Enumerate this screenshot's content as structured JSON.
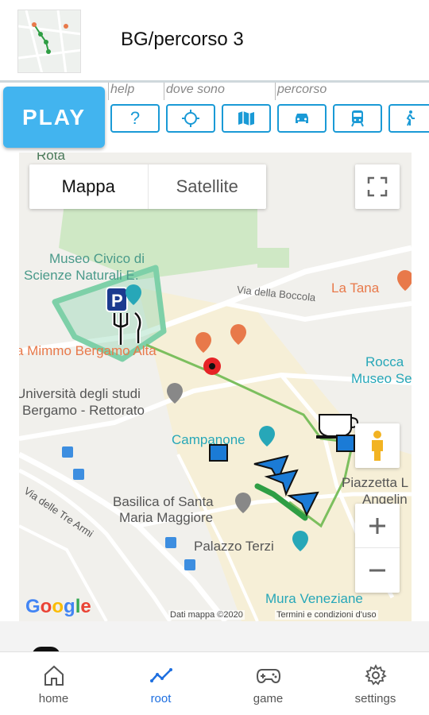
{
  "header": {
    "title": "BG/percorso 3"
  },
  "play_label": "PLAY",
  "categories": [
    {
      "label": "help"
    },
    {
      "label": "dove sono"
    },
    {
      "label": "percorso"
    }
  ],
  "toolbar": [
    {
      "icon": "question-icon",
      "text": "?"
    },
    {
      "icon": "locate-icon"
    },
    {
      "icon": "map-icon"
    },
    {
      "icon": "car-icon"
    },
    {
      "icon": "train-icon"
    },
    {
      "icon": "walk-icon"
    }
  ],
  "map": {
    "type_controls": {
      "map": "Mappa",
      "satellite": "Satellite"
    },
    "labels": {
      "rota": "Rota",
      "museo_civico_1": "Museo Civico di",
      "museo_civico_2": "Scienze Naturali E.",
      "via_boccola": "Via della Boccola",
      "la_tana": "La Tana",
      "mimmo": "a Mimmo Bergamo Alta",
      "rocca_1": "Rocca",
      "rocca_2": "Museo Ses",
      "universita_1": "Università degli studi",
      "universita_2": "Bergamo - Rettorato",
      "campanone": "Campanone",
      "via_tre_armi": "Via delle Tre Armi",
      "basilica_1": "Basilica of Santa",
      "basilica_2": "Maria Maggiore",
      "piazzetta_1": "Piazzetta L",
      "piazzetta_2": "Angelin",
      "palazzo_terzi": "Palazzo Terzi",
      "mura": "Mura Veneziane"
    },
    "google": "Google",
    "attribution_data": "Dati mappa ©2020",
    "attribution_terms": "Termini e condizioni d'uso",
    "colors": {
      "route": "#7cbf5e",
      "zone": "#7ed0a8",
      "poi_orange": "#e8794a",
      "poi_teal": "#27a7b8"
    }
  },
  "bottom_nav": [
    {
      "label": "home",
      "icon": "home-icon"
    },
    {
      "label": "root",
      "icon": "route-icon",
      "active": true
    },
    {
      "label": "game",
      "icon": "gamepad-icon"
    },
    {
      "label": "settings",
      "icon": "gear-icon"
    }
  ]
}
